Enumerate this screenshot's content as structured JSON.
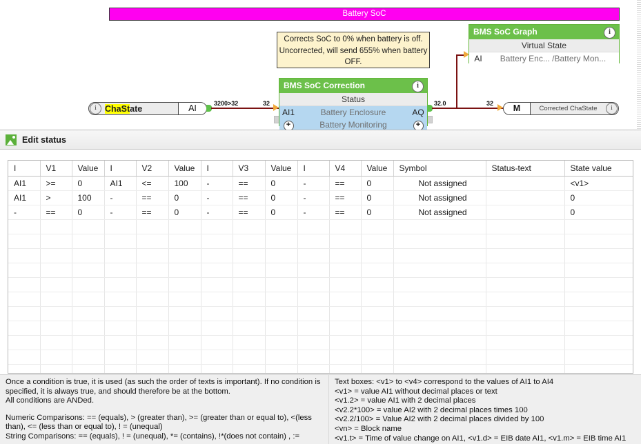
{
  "diagram": {
    "group_bar": {
      "label": "Battery SoC",
      "color": "#ff00f0"
    },
    "note": {
      "text": "Corrects SoC to 0% when battery is off. Uncorrected, will send 655% when battery OFF."
    },
    "chastate": {
      "info_glyph": "i",
      "name_highlighted": "ChaSt",
      "name_rest": "ate",
      "type": "AI"
    },
    "correction_block": {
      "title": "BMS SoC Correction",
      "info_glyph": "i",
      "subtitle": "Status",
      "in_pin": "AI1",
      "row1_text": "Battery Enclosure",
      "out_pin": "AQ",
      "row2_text": "Battery Monitoring",
      "expand_left": "+",
      "expand_right": "+",
      "accent": "#6cc04a"
    },
    "graph_block": {
      "title": "BMS SoC Graph",
      "info_glyph": "i",
      "subtitle": "Virtual State",
      "in_pin": "AI",
      "row1_text": "Battery Enc... /Battery Mon...",
      "accent": "#6cc04a"
    },
    "corrected": {
      "type": "M",
      "name": "Corrected ChaState",
      "info_glyph": "i"
    },
    "wires": {
      "label_src_out": "3200>32",
      "label_in_correction": "32",
      "label_correction_out": "32.0",
      "label_into_m": "32",
      "color": "#7b1212"
    }
  },
  "toolbar": {
    "icon": "edit-status-icon",
    "label": "Edit status"
  },
  "table": {
    "headers": [
      "I",
      "V1",
      "Value",
      "I",
      "V2",
      "Value",
      "I",
      "V3",
      "Value",
      "I",
      "V4",
      "Value",
      "Symbol",
      "Status-text",
      "State value"
    ],
    "rows": [
      [
        "AI1",
        ">=",
        "0",
        "AI1",
        "<=",
        "100",
        "-",
        "==",
        "0",
        "-",
        "==",
        "0",
        "Not assigned",
        "",
        "<v1>"
      ],
      [
        "AI1",
        ">",
        "100",
        "-",
        "==",
        "0",
        "-",
        "==",
        "0",
        "-",
        "==",
        "0",
        "Not assigned",
        "",
        "0"
      ],
      [
        "-",
        "==",
        "0",
        "-",
        "==",
        "0",
        "-",
        "==",
        "0",
        "-",
        "==",
        "0",
        "Not assigned",
        "",
        "0"
      ]
    ],
    "empty_row_count": 11
  },
  "help": {
    "left": [
      "Once a condition is true, it is used (as such the order of texts is important). If no condition is specified, it is always true, and should therefore be at the bottom.",
      "All conditions are ANDed.",
      "Numeric Comparisons: == (equals), > (greater than), >= (greater than or equal to), <(less than), <= (less than or equal to), ! = (unequal)",
      "String Comparisons: == (equals), ! = (unequal), *= (contains), !*(does not contain) , :="
    ],
    "right": [
      "Text boxes: <v1> to <v4> correspond to the values of AI1 to AI4",
      "<v1> = value AI1 without decimal places or text",
      "<v1.2> = value AI1 with 2 decimal places",
      "<v2.2*100> = value AI2 with 2 decimal places times 100",
      "<v2.2/100> = Value AI2 with 2 decimal places divided by 100",
      "<vn> = Block name",
      "<v1.t> = Time of value change on AI1, <v1.d> = EIB date AI1, <v1.m> = EIB time AI1"
    ]
  }
}
